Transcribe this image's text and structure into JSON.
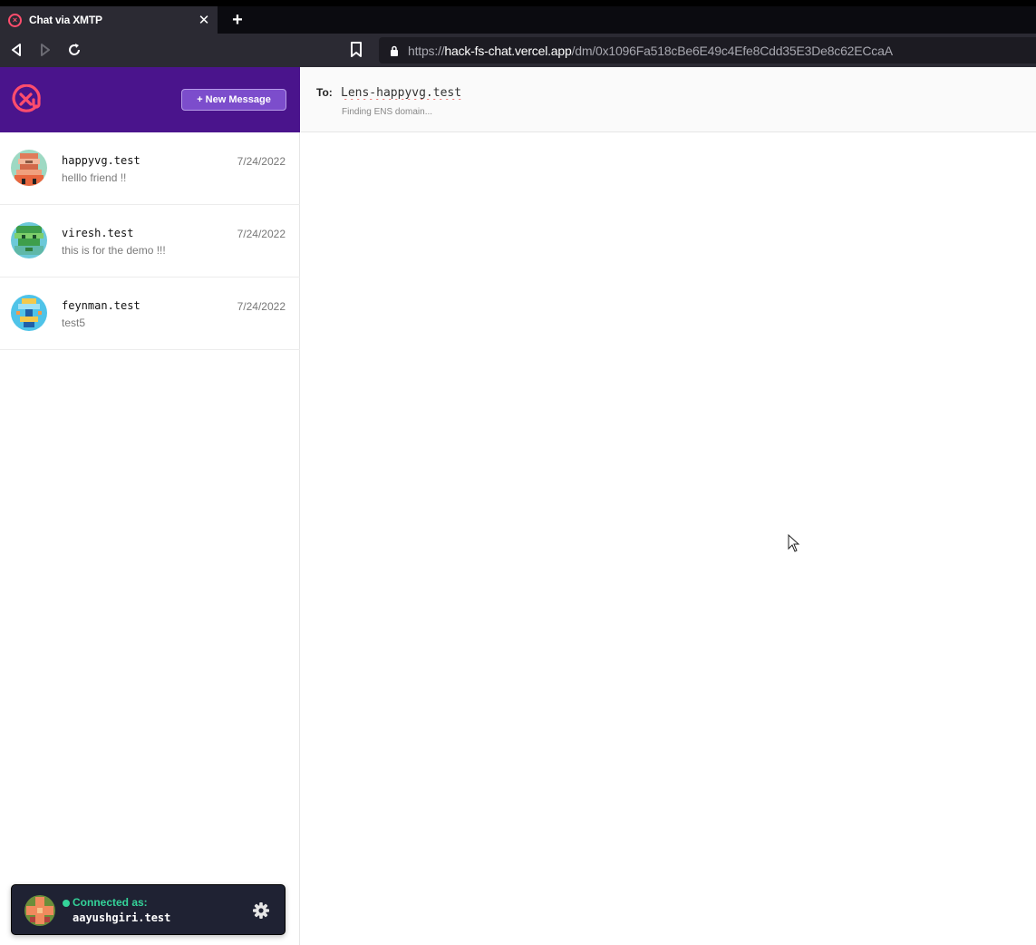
{
  "browser": {
    "tab_title": "Chat via XMTP",
    "url_scheme": "https://",
    "url_host": "hack-fs-chat.vercel.app",
    "url_path": "/dm/0x1096Fa518cBe6E49c4Efe8Cdd35E3De8c62ECcaA"
  },
  "sidebar": {
    "new_message_label": "+ New Message",
    "conversations": [
      {
        "name": "happyvg.test",
        "preview": "helllo friend !!",
        "date": "7/24/2022"
      },
      {
        "name": "viresh.test",
        "preview": "this is for the demo !!!",
        "date": "7/24/2022"
      },
      {
        "name": "feynman.test",
        "preview": "test5",
        "date": "7/24/2022"
      }
    ],
    "user": {
      "status_label": "Connected as:",
      "name": "aayushgiri.test"
    }
  },
  "main": {
    "to_label": "To:",
    "recipient_value": "Lens-happyvg.test",
    "hint": "Finding ENS domain..."
  },
  "colors": {
    "brand": "#4a148c",
    "accent": "#7c4dcc",
    "connected": "#34d399"
  }
}
